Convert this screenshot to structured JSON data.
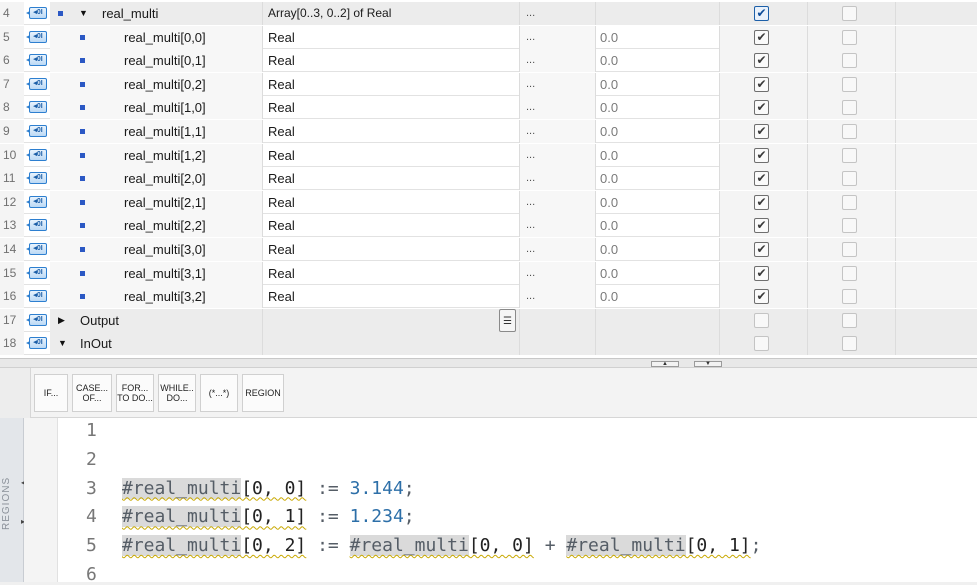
{
  "table": {
    "rows": [
      {
        "n": "4",
        "indent": "parent",
        "expanded": true,
        "name": "real_multi",
        "type": "Array[0..3, 0..2] of Real",
        "dots": "...",
        "default": "",
        "cb1": "on-blue",
        "cb2": "off"
      },
      {
        "n": "5",
        "indent": "child",
        "name": "real_multi[0,0]",
        "type": "Real",
        "dots": "...",
        "default": "0.0",
        "cb1": "on",
        "cb2": "off"
      },
      {
        "n": "6",
        "indent": "child",
        "name": "real_multi[0,1]",
        "type": "Real",
        "dots": "...",
        "default": "0.0",
        "cb1": "on",
        "cb2": "off"
      },
      {
        "n": "7",
        "indent": "child",
        "name": "real_multi[0,2]",
        "type": "Real",
        "dots": "...",
        "default": "0.0",
        "cb1": "on",
        "cb2": "off"
      },
      {
        "n": "8",
        "indent": "child",
        "name": "real_multi[1,0]",
        "type": "Real",
        "dots": "...",
        "default": "0.0",
        "cb1": "on",
        "cb2": "off"
      },
      {
        "n": "9",
        "indent": "child",
        "name": "real_multi[1,1]",
        "type": "Real",
        "dots": "...",
        "default": "0.0",
        "cb1": "on",
        "cb2": "off"
      },
      {
        "n": "10",
        "indent": "child",
        "name": "real_multi[1,2]",
        "type": "Real",
        "dots": "...",
        "default": "0.0",
        "cb1": "on",
        "cb2": "off"
      },
      {
        "n": "11",
        "indent": "child",
        "name": "real_multi[2,0]",
        "type": "Real",
        "dots": "...",
        "default": "0.0",
        "cb1": "on",
        "cb2": "off"
      },
      {
        "n": "12",
        "indent": "child",
        "name": "real_multi[2,1]",
        "type": "Real",
        "dots": "...",
        "default": "0.0",
        "cb1": "on",
        "cb2": "off"
      },
      {
        "n": "13",
        "indent": "child",
        "name": "real_multi[2,2]",
        "type": "Real",
        "dots": "...",
        "default": "0.0",
        "cb1": "on",
        "cb2": "off"
      },
      {
        "n": "14",
        "indent": "child",
        "name": "real_multi[3,0]",
        "type": "Real",
        "dots": "...",
        "default": "0.0",
        "cb1": "on",
        "cb2": "off"
      },
      {
        "n": "15",
        "indent": "child",
        "name": "real_multi[3,1]",
        "type": "Real",
        "dots": "...",
        "default": "0.0",
        "cb1": "on",
        "cb2": "off"
      },
      {
        "n": "16",
        "indent": "child",
        "name": "real_multi[3,2]",
        "type": "Real",
        "dots": "...",
        "default": "0.0",
        "cb1": "on",
        "cb2": "off"
      },
      {
        "n": "17",
        "indent": "section",
        "expanded": false,
        "name": "Output",
        "type": "",
        "dots": "",
        "default": "",
        "cb1": "off",
        "cb2": "off",
        "listbtn": true
      },
      {
        "n": "18",
        "indent": "section",
        "expanded": true,
        "name": "InOut",
        "type": "",
        "dots": "",
        "default": "",
        "cb1": "off",
        "cb2": "off"
      }
    ]
  },
  "toolbar": {
    "buttons": [
      {
        "id": "if",
        "line1": "IF...",
        "line2": ""
      },
      {
        "id": "case",
        "line1": "CASE...",
        "line2": "OF..."
      },
      {
        "id": "for",
        "line1": "FOR...",
        "line2": "TO DO..."
      },
      {
        "id": "while",
        "line1": "WHILE..",
        "line2": "DO..."
      },
      {
        "id": "comment",
        "line1": "(*...*)",
        "line2": ""
      },
      {
        "id": "region",
        "line1": "REGION",
        "line2": ""
      }
    ]
  },
  "sidebar": {
    "label": "REGIONS"
  },
  "editor": {
    "lines": [
      {
        "n": "1",
        "tokens": []
      },
      {
        "n": "2",
        "tokens": []
      },
      {
        "n": "3",
        "tokens": [
          {
            "t": "var",
            "s": "#real_multi"
          },
          {
            "t": "sq",
            "s": "[0, 0]"
          },
          {
            "t": "pun",
            "s": " := "
          },
          {
            "t": "num",
            "s": "3.144"
          },
          {
            "t": "pun",
            "s": ";"
          }
        ]
      },
      {
        "n": "4",
        "tokens": [
          {
            "t": "var",
            "s": "#real_multi"
          },
          {
            "t": "sq",
            "s": "[0, 1]"
          },
          {
            "t": "pun",
            "s": " := "
          },
          {
            "t": "num",
            "s": "1.234"
          },
          {
            "t": "pun",
            "s": ";"
          }
        ]
      },
      {
        "n": "5",
        "tokens": [
          {
            "t": "var",
            "s": "#real_multi"
          },
          {
            "t": "sq",
            "s": "[0, 2]"
          },
          {
            "t": "pun",
            "s": " := "
          },
          {
            "t": "var",
            "s": "#real_multi"
          },
          {
            "t": "sq",
            "s": "[0, 0]"
          },
          {
            "t": "pun",
            "s": " + "
          },
          {
            "t": "var",
            "s": "#real_multi"
          },
          {
            "t": "sq",
            "s": "[0, 1]"
          },
          {
            "t": "pun",
            "s": ";"
          }
        ]
      },
      {
        "n": "6",
        "tokens": []
      }
    ]
  }
}
